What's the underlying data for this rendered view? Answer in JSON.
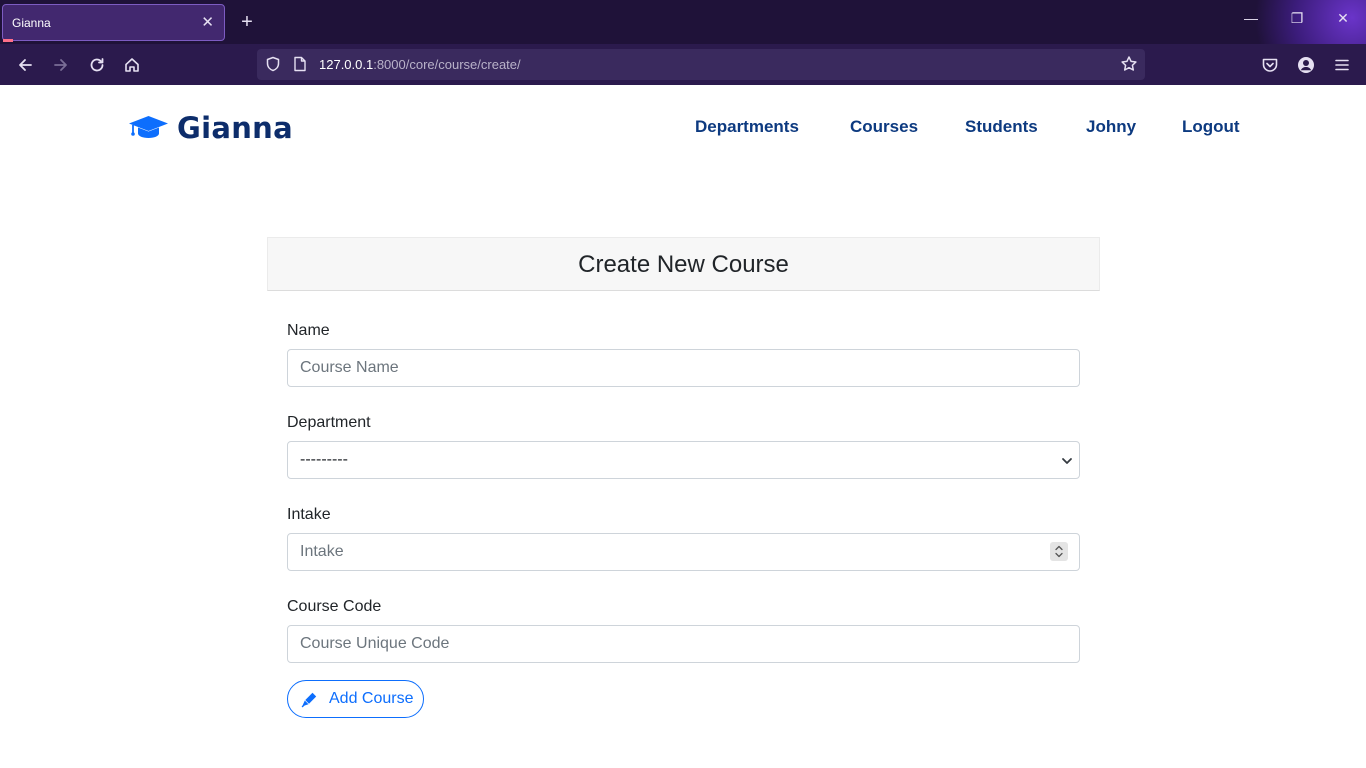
{
  "browser": {
    "tab_title": "Gianna",
    "url_host": "127.0.0.1",
    "url_path": ":8000/core/course/create/"
  },
  "site": {
    "brand": "Gianna",
    "nav": [
      {
        "label": "Departments"
      },
      {
        "label": "Courses"
      },
      {
        "label": "Students"
      },
      {
        "label": "Johny"
      },
      {
        "label": "Logout"
      }
    ]
  },
  "form": {
    "title": "Create New Course",
    "name": {
      "label": "Name",
      "placeholder": "Course Name"
    },
    "department": {
      "label": "Department",
      "value": "---------"
    },
    "intake": {
      "label": "Intake",
      "placeholder": "Intake"
    },
    "code": {
      "label": "Course Code",
      "placeholder": "Course Unique Code"
    },
    "submit_label": "Add Course"
  },
  "colors": {
    "brand": "#0d2d6b",
    "nav_link": "#0d3a80",
    "primary": "#0d6efd",
    "browser_bg": "#1f1239"
  }
}
